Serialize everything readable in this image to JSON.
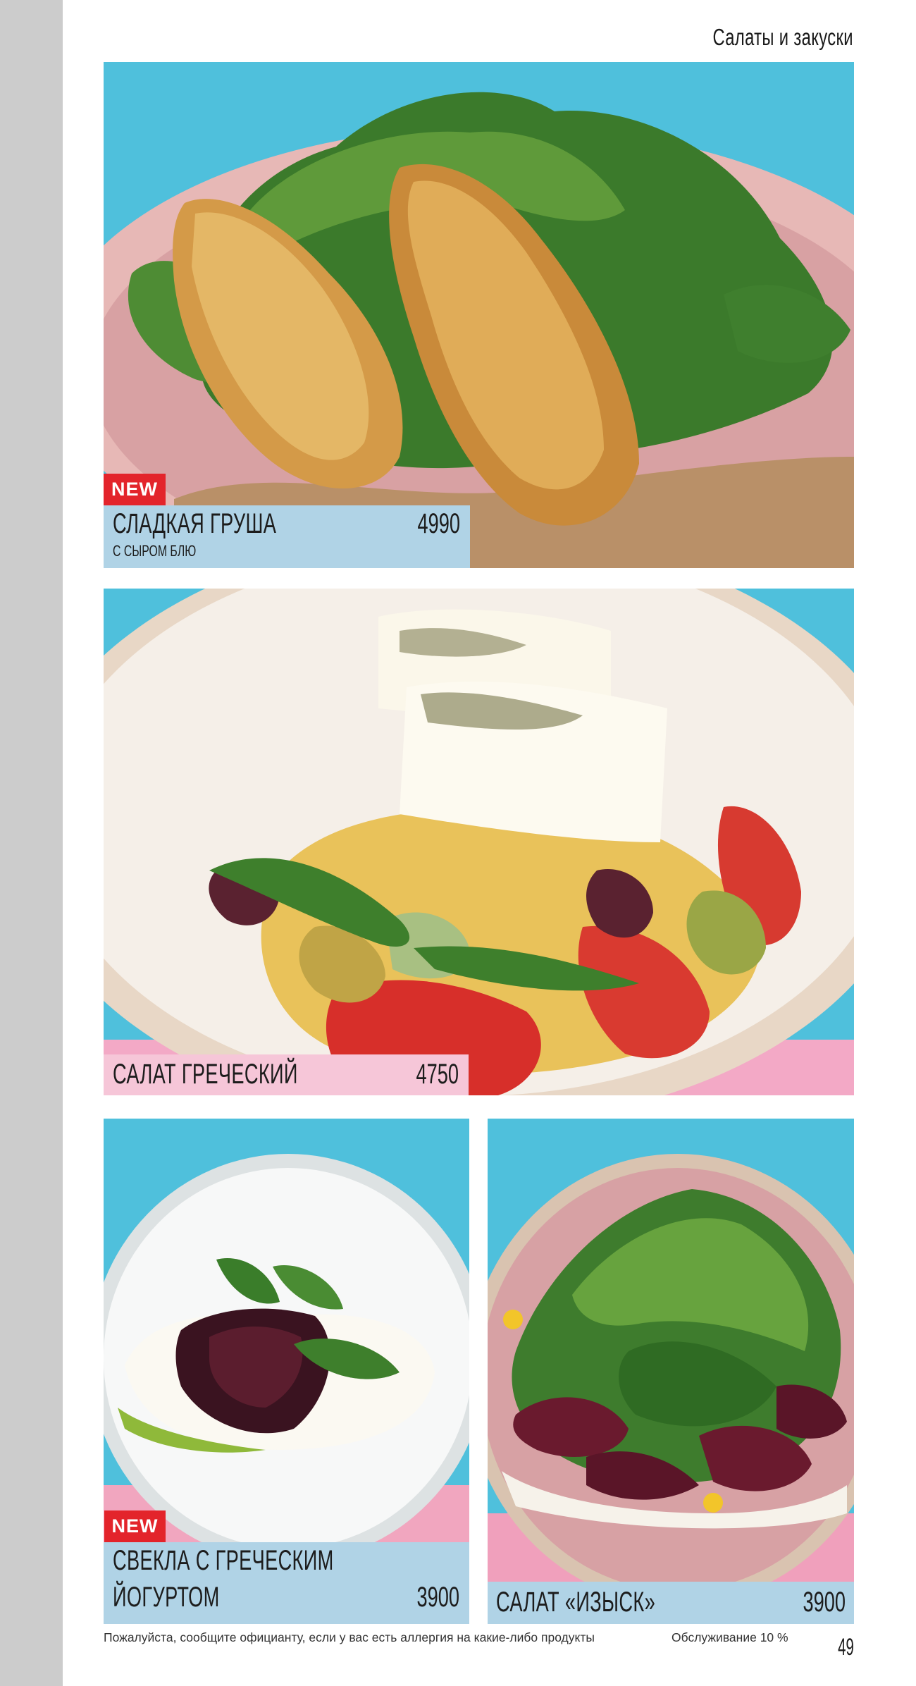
{
  "page": {
    "section_title": "Салаты и закуски",
    "page_number": "49"
  },
  "dishes": [
    {
      "name": "СЛАДКАЯ ГРУША",
      "subtitle": "С СЫРОМ БЛЮ",
      "price": "4990",
      "badge": "NEW"
    },
    {
      "name": "САЛАТ ГРЕЧЕСКИЙ",
      "price": "4750"
    },
    {
      "name_line1": "СВЕКЛА С ГРЕЧЕСКИМ",
      "name_line2": "ЙОГУРТОМ",
      "price": "3900",
      "badge": "NEW"
    },
    {
      "name": "САЛАТ «ИЗЫСК»",
      "price": "3900"
    }
  ],
  "footer": {
    "allergy_note": "Пожалуйста, сообщите официанту, если у вас есть аллергия на какие-либо продукты",
    "service_note": "Обслуживание 10 %"
  },
  "colors": {
    "sidebar": "#cccccc",
    "label_blue": "#b0d3e6",
    "label_pink": "#f6c6d8",
    "badge_red": "#e3242b",
    "backdrop_cyan": "#4fc0dc"
  }
}
